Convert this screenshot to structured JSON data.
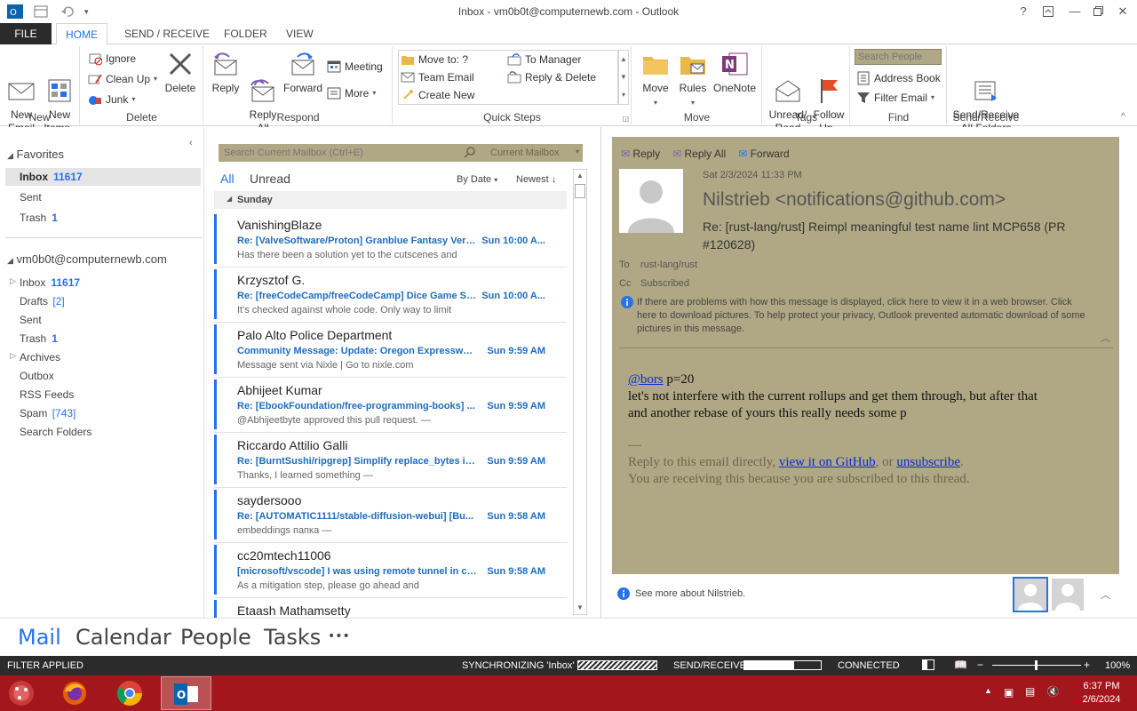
{
  "window": {
    "title": "Inbox - vm0b0t@computernewb.com - Outlook"
  },
  "tabs": [
    "FILE",
    "HOME",
    "SEND / RECEIVE",
    "FOLDER",
    "VIEW"
  ],
  "ribbon": {
    "new": {
      "new_email": "New\nEmail",
      "new_items": "New\nItems",
      "label": "New"
    },
    "delete": {
      "ignore": "Ignore",
      "clean_up": "Clean Up",
      "junk": "Junk",
      "delete": "Delete",
      "label": "Delete"
    },
    "respond": {
      "reply": "Reply",
      "reply_all": "Reply\nAll",
      "forward": "Forward",
      "meeting": "Meeting",
      "more": "More",
      "label": "Respond"
    },
    "quick_steps": {
      "move_to": "Move to: ?",
      "to_manager": "To Manager",
      "team_email": "Team Email",
      "reply_delete": "Reply & Delete",
      "create_new": "Create New",
      "label": "Quick Steps"
    },
    "move": {
      "move": "Move",
      "rules": "Rules",
      "onenote": "OneNote",
      "label": "Move"
    },
    "tags": {
      "unread_read": "Unread/\nRead",
      "follow_up": "Follow\nUp",
      "label": "Tags"
    },
    "find": {
      "search_people_placeholder": "Search People",
      "address_book": "Address Book",
      "filter_email": "Filter Email",
      "label": "Find"
    },
    "send_receive": {
      "btn": "Send/Receive\nAll Folders",
      "label": "Send/Receive"
    }
  },
  "nav": {
    "favorites_label": "Favorites",
    "favorites": [
      {
        "name": "Inbox",
        "count": "11617"
      },
      {
        "name": "Sent",
        "count": ""
      },
      {
        "name": "Trash",
        "count": "1"
      }
    ],
    "account": "vm0b0t@computernewb.com",
    "folders": [
      {
        "name": "Inbox",
        "count": "11617",
        "style": "bold"
      },
      {
        "name": "Drafts",
        "count": "[2]",
        "style": "bracket"
      },
      {
        "name": "Sent",
        "count": "",
        "style": ""
      },
      {
        "name": "Trash",
        "count": "1",
        "style": "bold"
      },
      {
        "name": "Archives",
        "count": "",
        "style": ""
      },
      {
        "name": "Outbox",
        "count": "",
        "style": ""
      },
      {
        "name": "RSS Feeds",
        "count": "",
        "style": ""
      },
      {
        "name": "Spam",
        "count": "[743]",
        "style": "bracket"
      },
      {
        "name": "Search Folders",
        "count": "",
        "style": ""
      }
    ]
  },
  "list": {
    "search_placeholder": "Search Current Mailbox (Ctrl+E)",
    "search_scope": "Current Mailbox",
    "filter_all": "All",
    "filter_unread": "Unread",
    "sort_by": "By Date",
    "sort_order": "Newest",
    "group_header": "Sunday",
    "messages": [
      {
        "sender": "VanishingBlaze",
        "subject": "Re: [ValveSoftware/Proton] Granblue Fantasy Vers...",
        "time": "Sun 10:00 A...",
        "preview": "Has there been a solution yet to the cutscenes and"
      },
      {
        "sender": "Krzysztof G.",
        "subject": "Re: [freeCodeCamp/freeCodeCamp] Dice Game Ste...",
        "time": "Sun 10:00 A...",
        "preview": "It's checked against whole code. Only way to limit"
      },
      {
        "sender": "Palo Alto Police Department",
        "subject": "Community Message: Update: Oregon Expressway...",
        "time": "Sun 9:59 AM",
        "preview": "Message sent via Nixle | Go to nixle.com"
      },
      {
        "sender": "Abhijeet Kumar",
        "subject": "Re: [EbookFoundation/free-programming-books] ...",
        "time": "Sun 9:59 AM",
        "preview": "@Abhijeetbyte approved this pull request.  —"
      },
      {
        "sender": "Riccardo Attilio Galli",
        "subject": "Re: [BurntSushi/ripgrep] Simplify replace_bytes in ...",
        "time": "Sun 9:59 AM",
        "preview": "Thanks, I learned something  —"
      },
      {
        "sender": "saydersooo",
        "subject": "Re: [AUTOMATIC1111/stable-diffusion-webui] [Bu...",
        "time": "Sun 9:58 AM",
        "preview": "embeddings папка  —"
      },
      {
        "sender": "cc20mtech11006",
        "subject": "[microsoft/vscode] I was using remote tunnel in ce...",
        "time": "Sun 9:58 AM",
        "preview": "        As a mitigation step, please go ahead and"
      },
      {
        "sender": "Etaash Mathamsetty",
        "subject": "",
        "time": "",
        "preview": ""
      }
    ]
  },
  "reading": {
    "actions": {
      "reply": "Reply",
      "reply_all": "Reply All",
      "forward": "Forward"
    },
    "date": "Sat 2/3/2024 11:33 PM",
    "from": "Nilstrieb <notifications@github.com>",
    "subject": "Re: [rust-lang/rust] Reimpl meaningful test name lint MCP658 (PR #120628)",
    "to_label": "To",
    "to": "rust-lang/rust",
    "cc_label": "Cc",
    "cc": "Subscribed",
    "info": "If there are problems with how this message is displayed, click here to view it in a web browser. Click here to download pictures. To help protect your privacy, Outlook prevented automatic download of some pictures in this message.",
    "body_mention": "@bors",
    "body_line1_rest": " p=20",
    "body_line2": "let's not interfere with the current rollups and get them through, but after that",
    "body_line3": "and another rebase of yours this really needs some p",
    "sig_dash": "—",
    "footer_pre": "Reply to this email directly, ",
    "footer_link1": "view it on GitHub",
    "footer_mid": ", or ",
    "footer_link2": "unsubscribe",
    "footer_end": ".",
    "footer_line2": "You are receiving this because you are subscribed to this thread.",
    "people_pane": "See more about Nilstrieb."
  },
  "bottomnav": [
    "Mail",
    "Calendar",
    "People",
    "Tasks",
    "•••"
  ],
  "status": {
    "filter": "FILTER APPLIED",
    "sync": "SYNCHRONIZING 'Inbox'",
    "sendrecv": "SEND/RECEIVE",
    "connected": "CONNECTED",
    "zoom": "100%"
  },
  "taskbar": {
    "time": "6:37 PM",
    "date": "2/6/2024"
  },
  "colors": {
    "accent": "#2672ec",
    "pane": "#b0a884",
    "statusbar": "#2b2b2b",
    "taskbar": "#a3171c"
  }
}
